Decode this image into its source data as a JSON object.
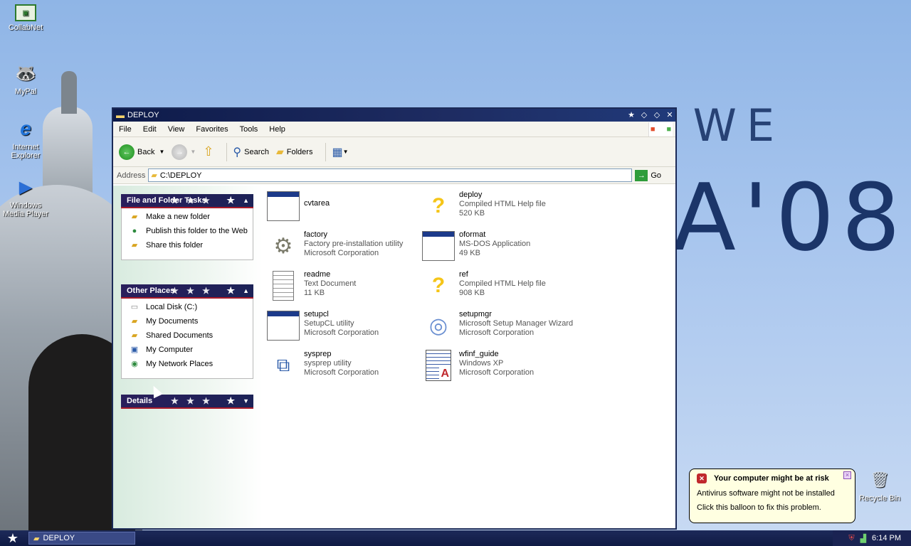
{
  "desktop": {
    "icons": [
      {
        "label": "CollabNet",
        "icon": "collabnet-icon"
      },
      {
        "label": "MyPal",
        "icon": "mypal-icon"
      },
      {
        "label": "Internet Explorer",
        "icon": "internet-explorer-icon"
      },
      {
        "label": "Windows Media Player",
        "icon": "media-player-icon"
      },
      {
        "label": "Recycle Bin",
        "icon": "recycle-bin-icon"
      }
    ],
    "wallpaper_text_1": "CHANGE WE NEED",
    "wallpaper_text_2": "A'08"
  },
  "window": {
    "title": "DEPLOY",
    "menu": [
      "File",
      "Edit",
      "View",
      "Favorites",
      "Tools",
      "Help"
    ],
    "toolbar": {
      "back": "Back",
      "search": "Search",
      "folders": "Folders"
    },
    "address": {
      "label": "Address",
      "value": "C:\\DEPLOY",
      "go": "Go"
    },
    "panels": {
      "tasks": {
        "title": "File and Folder Tasks",
        "items": [
          "Make a new folder",
          "Publish this folder to the Web",
          "Share this folder"
        ]
      },
      "places": {
        "title": "Other Places",
        "items": [
          "Local Disk (C:)",
          "My Documents",
          "Shared Documents",
          "My Computer",
          "My Network Places"
        ]
      },
      "details": {
        "title": "Details"
      }
    },
    "files": [
      {
        "name": "cvtarea",
        "line2": "",
        "line3": "",
        "icon": "app-window-icon"
      },
      {
        "name": "deploy",
        "line2": "Compiled HTML Help file",
        "line3": "520 KB",
        "icon": "help-file-icon"
      },
      {
        "name": "factory",
        "line2": "Factory pre-installation utility",
        "line3": "Microsoft Corporation",
        "icon": "gears-icon"
      },
      {
        "name": "oformat",
        "line2": "MS-DOS Application",
        "line3": "49 KB",
        "icon": "app-window-icon"
      },
      {
        "name": "readme",
        "line2": "Text Document",
        "line3": "11 KB",
        "icon": "text-document-icon"
      },
      {
        "name": "ref",
        "line2": "Compiled HTML Help file",
        "line3": "908 KB",
        "icon": "help-file-icon"
      },
      {
        "name": "setupcl",
        "line2": "SetupCL utility",
        "line3": "Microsoft Corporation",
        "icon": "app-window-icon"
      },
      {
        "name": "setupmgr",
        "line2": "Microsoft Setup Manager Wizard",
        "line3": "Microsoft Corporation",
        "icon": "setup-cd-icon"
      },
      {
        "name": "sysprep",
        "line2": "sysprep utility",
        "line3": "Microsoft Corporation",
        "icon": "network-computers-icon"
      },
      {
        "name": "wfinf_guide",
        "line2": "Windows XP",
        "line3": "Microsoft Corporation",
        "icon": "document-icon"
      }
    ]
  },
  "taskbar": {
    "item": "DEPLOY",
    "clock": "6:14 PM"
  },
  "balloon": {
    "title": "Your computer might be at risk",
    "line1": "Antivirus software might not be installed",
    "line2": "Click this balloon to fix this problem."
  }
}
